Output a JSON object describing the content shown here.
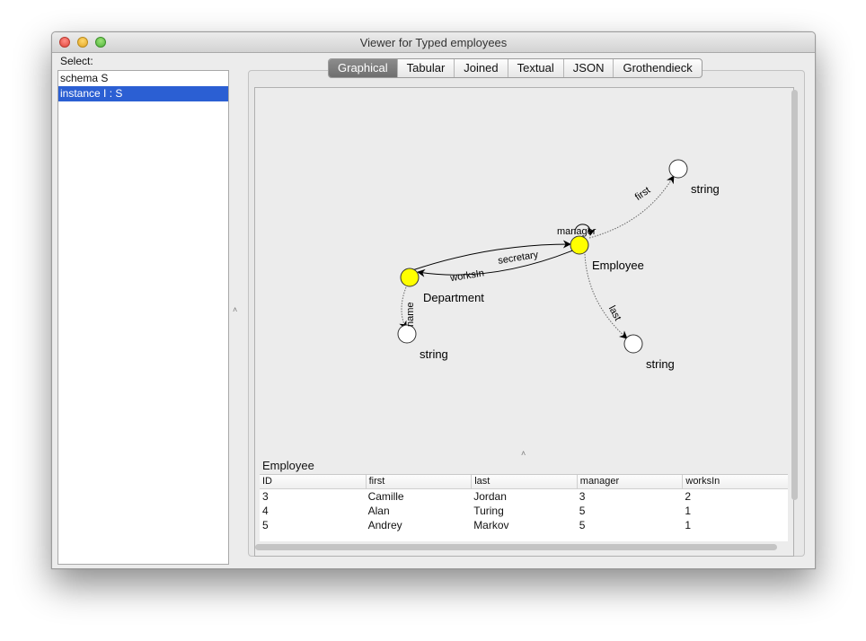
{
  "window": {
    "title": "Viewer for Typed employees"
  },
  "sidebar": {
    "label": "Select:",
    "items": [
      {
        "label": "schema S",
        "selected": false
      },
      {
        "label": "instance I : S",
        "selected": true
      }
    ]
  },
  "tabs": [
    {
      "label": "Graphical",
      "active": true
    },
    {
      "label": "Tabular",
      "active": false
    },
    {
      "label": "Joined",
      "active": false
    },
    {
      "label": "Textual",
      "active": false
    },
    {
      "label": "JSON",
      "active": false
    },
    {
      "label": "Grothendieck",
      "active": false
    }
  ],
  "graph": {
    "nodes": {
      "department": "Department",
      "employee": "Employee",
      "string_name": "string",
      "string_first": "string",
      "string_last": "string"
    },
    "edges": {
      "secretary": "secretary",
      "worksIn": "worksIn",
      "manager": "manager",
      "first": "first",
      "last": "last",
      "name": "name"
    },
    "colors": {
      "entity_node": "#ffff00",
      "attribute_node": "#ffffff"
    }
  },
  "table": {
    "title": "Employee",
    "columns": [
      "ID",
      "first",
      "last",
      "manager",
      "worksIn"
    ],
    "rows": [
      [
        "3",
        "Camille",
        "Jordan",
        "3",
        "2"
      ],
      [
        "4",
        "Alan",
        "Turing",
        "5",
        "1"
      ],
      [
        "5",
        "Andrey",
        "Markov",
        "5",
        "1"
      ]
    ]
  },
  "colors": {
    "selection": "#2b5fd3",
    "active_tab": "#7d7d7d"
  }
}
